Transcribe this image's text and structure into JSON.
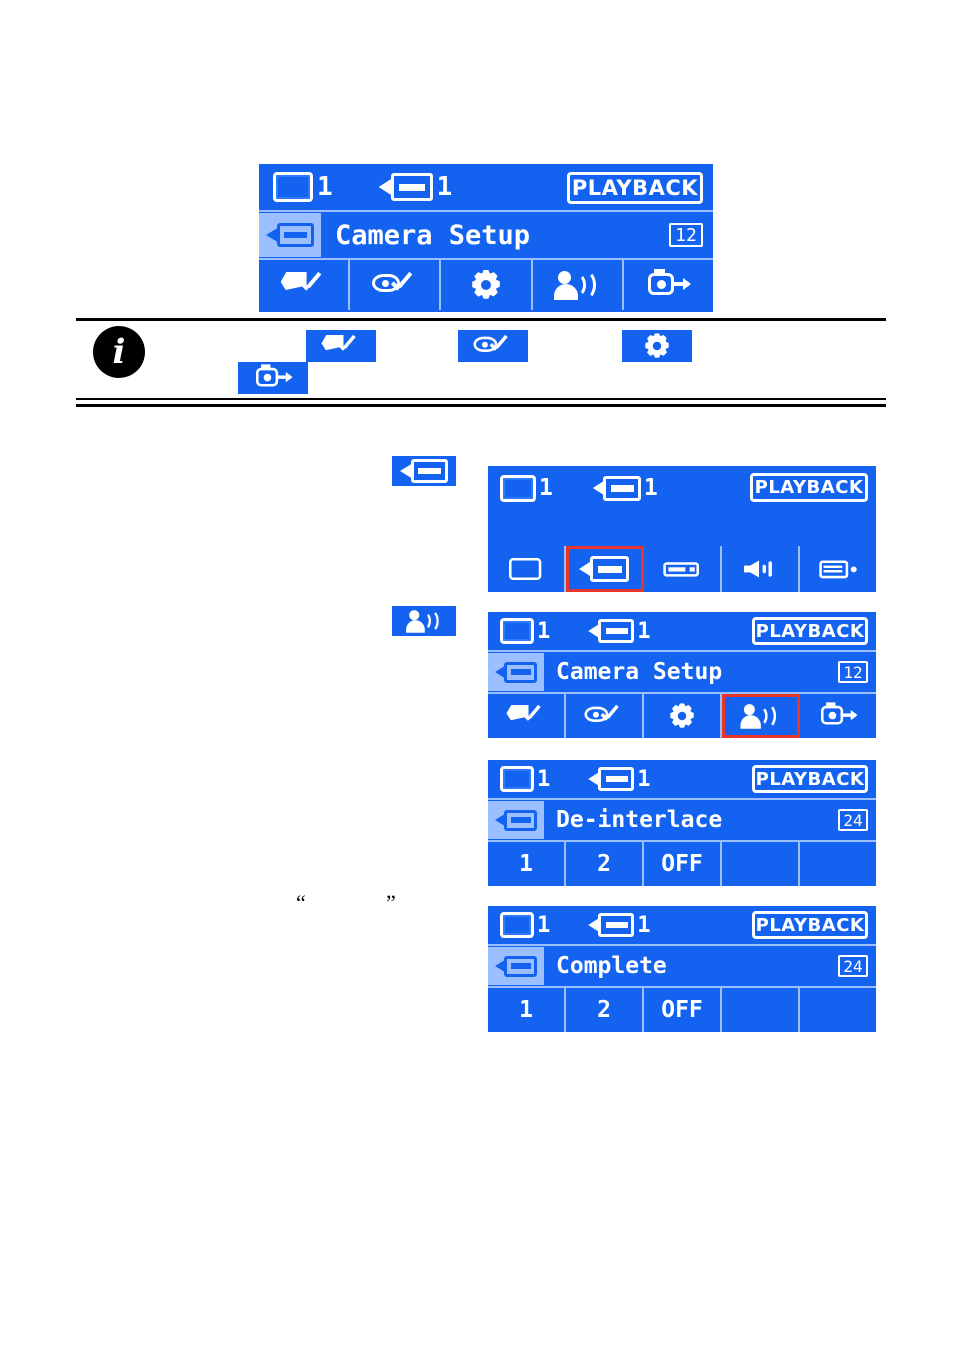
{
  "doc": {
    "quote_open": "“",
    "quote_close": "”"
  },
  "panels": {
    "main_menu": {
      "status": {
        "tv_number": "1",
        "cam_number": "1",
        "playback": "PLAYBACK"
      },
      "title": {
        "text": "Camera Setup",
        "badge": "12"
      },
      "icons": [
        "flag-check-icon",
        "eye-check-icon",
        "gear-icon",
        "person-arcs-icon",
        "camera-exit-icon"
      ],
      "selected_index": -1
    },
    "step_cam": {
      "status": {
        "tv_number": "1",
        "cam_number": "1",
        "playback": "PLAYBACK"
      },
      "icons": [
        "tv-icon",
        "camcorder-icon",
        "deck-icon",
        "speaker-icon",
        "monitor-icon"
      ],
      "selected_index": 1
    },
    "step_person": {
      "status": {
        "tv_number": "1",
        "cam_number": "1",
        "playback": "PLAYBACK"
      },
      "title": {
        "text": "Camera Setup",
        "badge": "12"
      },
      "icons": [
        "flag-check-icon",
        "eye-check-icon",
        "gear-icon",
        "person-arcs-icon",
        "camera-exit-icon"
      ],
      "selected_index": 3
    },
    "step_deinterlace": {
      "status": {
        "tv_number": "1",
        "cam_number": "1",
        "playback": "PLAYBACK"
      },
      "title": {
        "text": "De-interlace",
        "badge": "24"
      },
      "values": [
        "1",
        "2",
        "OFF",
        "",
        ""
      ]
    },
    "step_complete": {
      "status": {
        "tv_number": "1",
        "cam_number": "1",
        "playback": "PLAYBACK"
      },
      "title": {
        "text": "Complete",
        "badge": "24"
      },
      "values": [
        "1",
        "2",
        "OFF",
        "",
        ""
      ]
    }
  },
  "note": {
    "icon": "info-icon",
    "glyph": "i",
    "chips": [
      "flag-check-icon",
      "eye-check-icon",
      "gear-icon",
      "camera-exit-icon"
    ]
  },
  "callouts": {
    "cam_chip": "camcorder-icon",
    "person_chip": "person-arcs-icon"
  }
}
